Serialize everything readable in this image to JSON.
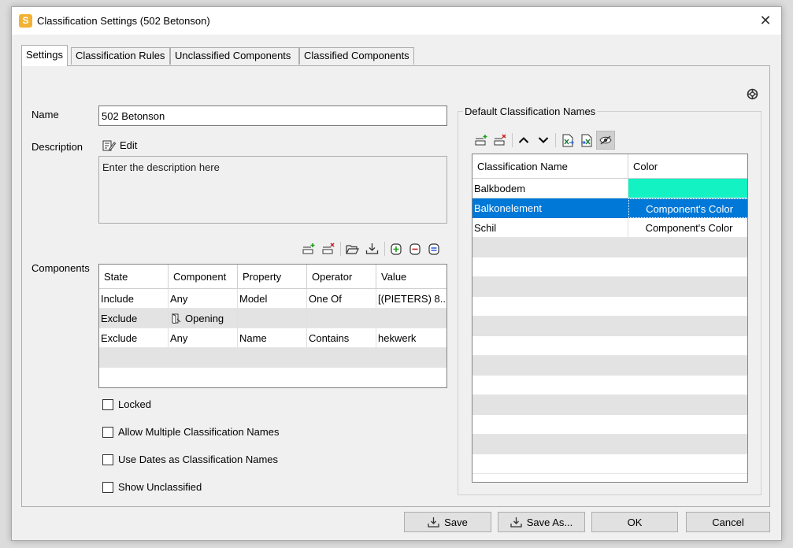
{
  "window": {
    "title": "Classification Settings (502 Betonson)",
    "app_icon_letter": "S"
  },
  "tabs": [
    "Settings",
    "Classification Rules",
    "Unclassified Components",
    "Classified Components"
  ],
  "settings": {
    "name_label": "Name",
    "name_value": "502 Betonson",
    "description_label": "Description",
    "edit_label": "Edit",
    "description_text": "Enter the description here",
    "components_label": "Components"
  },
  "components": {
    "headers": [
      "State",
      "Component",
      "Property",
      "Operator",
      "Value"
    ],
    "rows": [
      [
        "Include",
        "Any",
        "Model",
        "One Of",
        "[(PIETERS) 8..."
      ],
      [
        "Exclude",
        "Opening",
        "",
        "",
        ""
      ],
      [
        "Exclude",
        "Any",
        "Name",
        "Contains",
        "hekwerk"
      ]
    ]
  },
  "checkboxes": [
    {
      "label": "Locked",
      "checked": false
    },
    {
      "label": "Allow Multiple Classification Names",
      "checked": false
    },
    {
      "label": "Use Dates as Classification Names",
      "checked": false
    },
    {
      "label": "Show Unclassified",
      "checked": false
    }
  ],
  "default_names": {
    "group_title": "Default Classification Names",
    "headers": [
      "Classification Name",
      "Color"
    ],
    "rows": [
      {
        "name": "Balkbodem",
        "color": "",
        "swatch": "#12f2c3"
      },
      {
        "name": "Balkonelement",
        "color": "Component's Color",
        "selected": true
      },
      {
        "name": "Schil",
        "color": "Component's Color"
      }
    ]
  },
  "buttons": {
    "save": "Save",
    "save_as": "Save As...",
    "ok": "OK",
    "cancel": "Cancel"
  },
  "colors": {
    "selection": "#0078d7",
    "swatch": "#12f2c3",
    "alt_row": "#e3e3e3"
  }
}
